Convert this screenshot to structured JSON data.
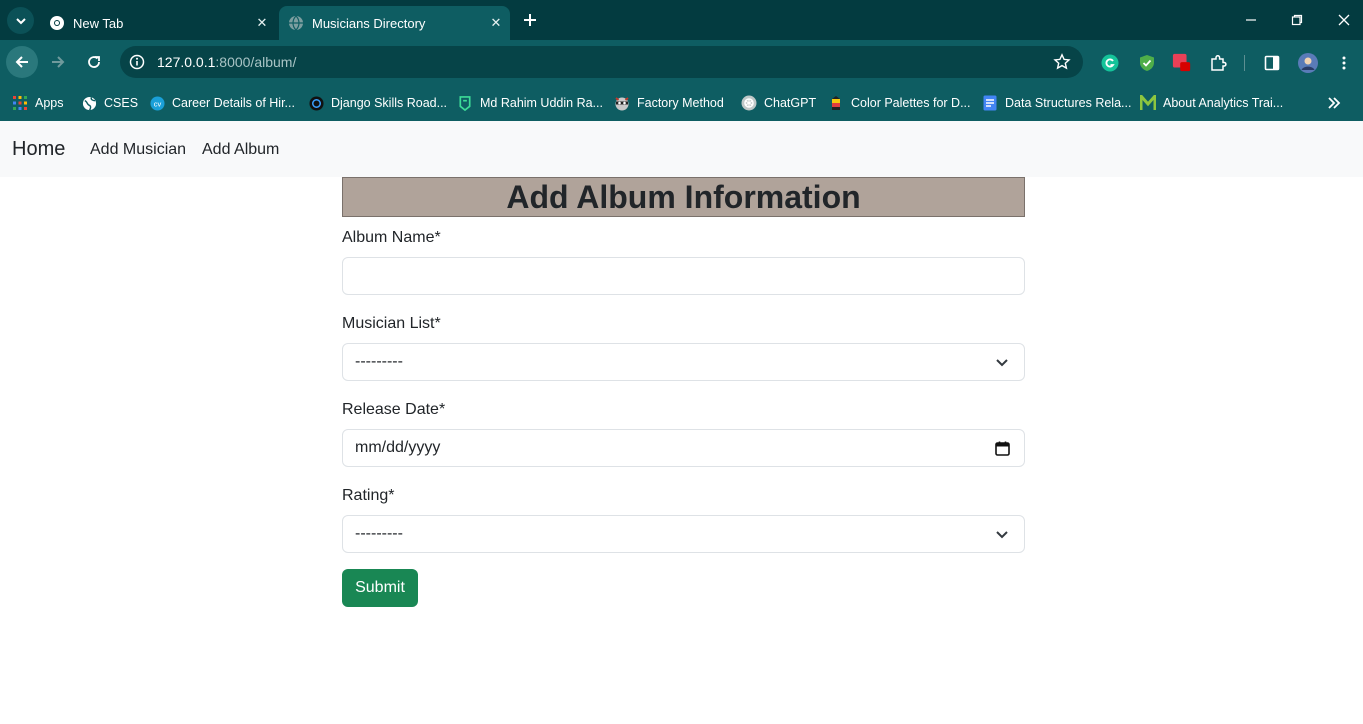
{
  "browser": {
    "tabs": [
      {
        "title": "New Tab",
        "active": false
      },
      {
        "title": "Musicians Directory",
        "active": true
      }
    ],
    "url_host": "127.0.0.1",
    "url_rest": ":8000/album/",
    "bookmarks": [
      {
        "label": "Apps",
        "icon": "apps-grid-icon"
      },
      {
        "label": "CSES",
        "icon": "globe-icon"
      },
      {
        "label": "Career Details of Hir...",
        "icon": "career-site-icon"
      },
      {
        "label": "Django Skills Road...",
        "icon": "roadmap-icon"
      },
      {
        "label": "Md Rahim Uddin Ra...",
        "icon": "profile-site-icon"
      },
      {
        "label": "Factory Method",
        "icon": "raccoon-icon"
      },
      {
        "label": "ChatGPT",
        "icon": "chatgpt-icon"
      },
      {
        "label": "Color Palettes for D...",
        "icon": "palette-site-icon"
      },
      {
        "label": "Data Structures Rela...",
        "icon": "docs-icon"
      },
      {
        "label": "About Analytics Trai...",
        "icon": "m-logo-icon"
      }
    ],
    "badge_count": "1"
  },
  "navbar": {
    "brand": "Home",
    "links": [
      "Add Musician",
      "Add Album"
    ]
  },
  "form": {
    "heading": "Add Album Information",
    "album_name_label": "Album Name*",
    "album_name_value": "",
    "musician_label": "Musician List*",
    "musician_value": "---------",
    "release_label": "Release Date*",
    "release_placeholder": "mm/dd/yyyy",
    "rating_label": "Rating*",
    "rating_value": "---------",
    "submit_label": "Submit"
  },
  "colors": {
    "chrome_dark": "#033b40",
    "chrome": "#0e5d62",
    "heading_bg": "#b0a39a",
    "submit_bg": "#198754"
  }
}
